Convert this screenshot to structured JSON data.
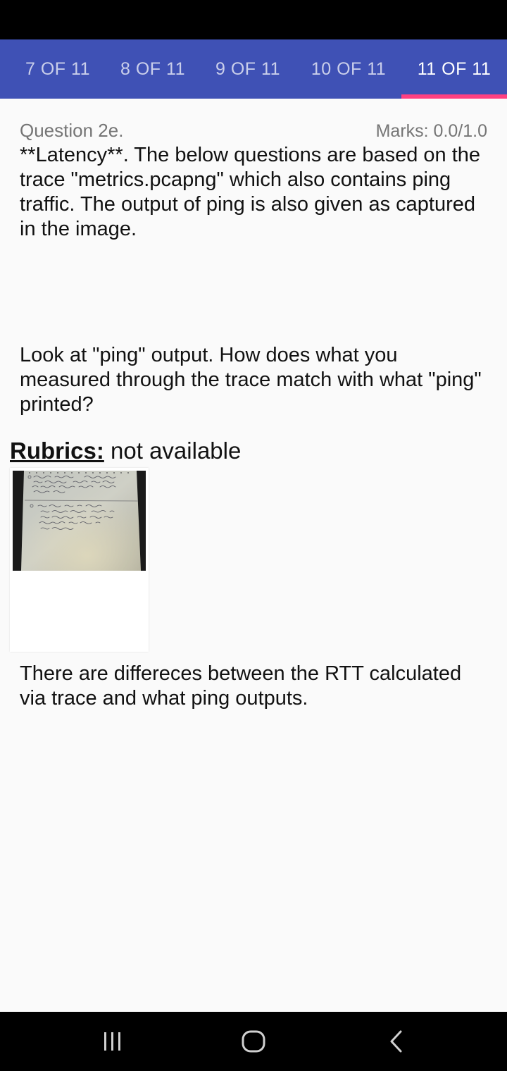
{
  "tabs": [
    {
      "label": "7 OF 11"
    },
    {
      "label": "8 OF 11"
    },
    {
      "label": "9 OF 11"
    },
    {
      "label": "10 OF 11"
    },
    {
      "label": "11 OF 11"
    }
  ],
  "question": {
    "title": "Question 2e.",
    "marks": "Marks: 0.0/1.0",
    "text": "**Latency**. The below questions are based on the trace \"metrics.pcapng\" which also contains ping traffic. The output of ping is also given as captured in the image.",
    "subquestion": "Look at \"ping\" output. How does what you measured through the trace match with what \"ping\" printed?"
  },
  "rubrics": {
    "label": "Rubrics:",
    "value": "not available"
  },
  "answer": {
    "text": "There are differeces between the RTT calculated via trace and what ping outputs."
  },
  "colors": {
    "tab_bar": "#3f51b5",
    "tab_indicator": "#ff4081",
    "background": "#fafafa"
  },
  "nav": {
    "recents_icon": "recents-icon",
    "home_icon": "home-icon",
    "back_icon": "back-icon"
  }
}
